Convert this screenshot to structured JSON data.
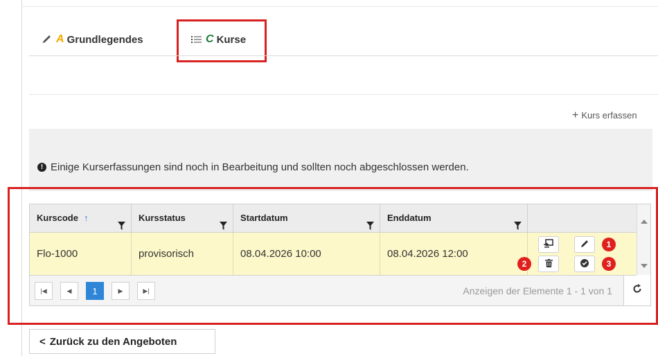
{
  "tabs": {
    "basics": {
      "letter": "A",
      "label": "Grundlegendes"
    },
    "courses": {
      "letter": "C",
      "label": "Kurse"
    }
  },
  "add_course": {
    "label": "Kurs erfassen"
  },
  "alert": {
    "text": "Einige Kurserfassungen sind noch in Bearbeitung und sollten noch abgeschlossen werden."
  },
  "grid": {
    "columns": [
      "Kurscode",
      "Kursstatus",
      "Startdatum",
      "Enddatum"
    ],
    "sort_indicator": "↑",
    "rows": [
      {
        "code": "Flo-1000",
        "status": "provisorisch",
        "start": "08.04.2026 10:00",
        "end": "08.04.2026 12:00"
      }
    ],
    "action_badges": [
      "1",
      "2",
      "3"
    ],
    "row_highlight_color": "#fdf8c9"
  },
  "pager": {
    "current_page": "1",
    "info": "Anzeigen der Elemente 1 - 1 von 1",
    "active_color": "#2f86d6"
  },
  "back_button": {
    "label": "Zurück zu den Angeboten"
  },
  "highlight_color": "#d82020"
}
